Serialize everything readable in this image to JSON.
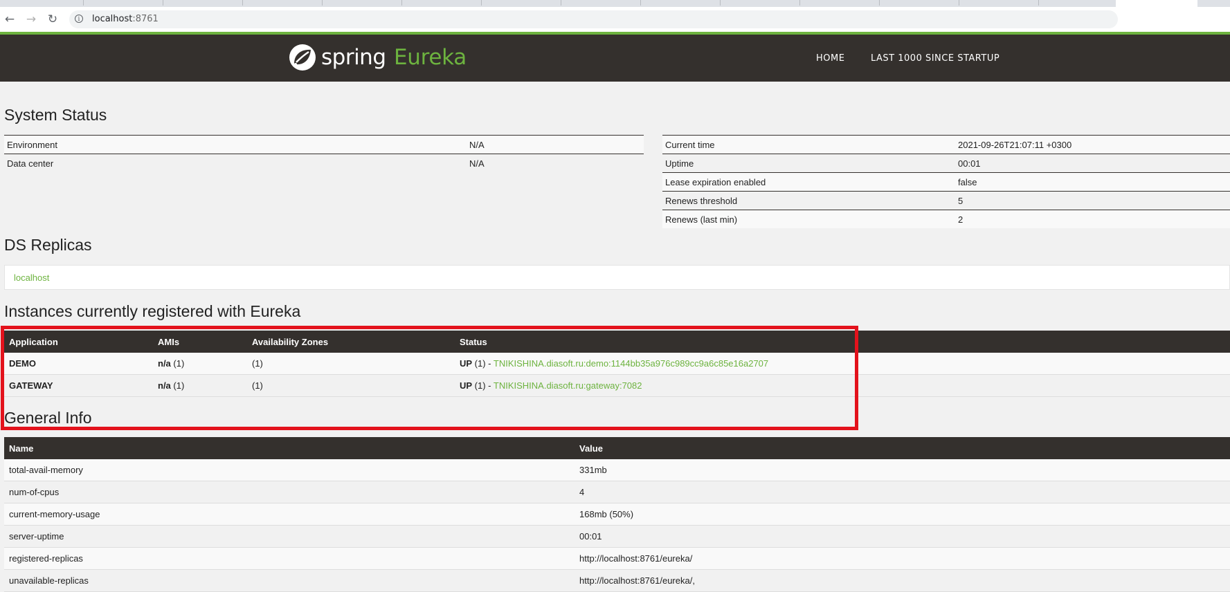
{
  "browser": {
    "url_host": "localhost",
    "url_port": ":8761"
  },
  "header": {
    "logo_spring": "spring",
    "logo_eureka": "Eureka",
    "nav": [
      {
        "label": "HOME"
      },
      {
        "label": "LAST 1000 SINCE STARTUP"
      }
    ]
  },
  "system_status": {
    "title": "System Status",
    "left": [
      {
        "key": "Environment",
        "value": "N/A"
      },
      {
        "key": "Data center",
        "value": "N/A"
      }
    ],
    "right": [
      {
        "key": "Current time",
        "value": "2021-09-26T21:07:11 +0300"
      },
      {
        "key": "Uptime",
        "value": "00:01"
      },
      {
        "key": "Lease expiration enabled",
        "value": "false"
      },
      {
        "key": "Renews threshold",
        "value": "5"
      },
      {
        "key": "Renews (last min)",
        "value": "2"
      }
    ]
  },
  "ds_replicas": {
    "title": "DS Replicas",
    "items": [
      "localhost"
    ]
  },
  "instances": {
    "title": "Instances currently registered with Eureka",
    "columns": [
      "Application",
      "AMIs",
      "Availability Zones",
      "Status"
    ],
    "rows": [
      {
        "application": "DEMO",
        "amis_bold": "n/a",
        "amis_count": " (1)",
        "zones": "(1)",
        "status_bold": "UP",
        "status_count": " (1) - ",
        "instance": "TNIKISHINA.diasoft.ru:demo:1144bb35a976c989cc9a6c85e16a2707"
      },
      {
        "application": "GATEWAY",
        "amis_bold": "n/a",
        "amis_count": " (1)",
        "zones": "(1)",
        "status_bold": "UP",
        "status_count": " (1) - ",
        "instance": "TNIKISHINA.diasoft.ru:gateway:7082"
      }
    ]
  },
  "general_info": {
    "title": "General Info",
    "columns": [
      "Name",
      "Value"
    ],
    "rows": [
      {
        "name": "total-avail-memory",
        "value": "331mb"
      },
      {
        "name": "num-of-cpus",
        "value": "4"
      },
      {
        "name": "current-memory-usage",
        "value": "168mb (50%)"
      },
      {
        "name": "server-uptime",
        "value": "00:01"
      },
      {
        "name": "registered-replicas",
        "value": "http://localhost:8761/eureka/"
      },
      {
        "name": "unavailable-replicas",
        "value": "http://localhost:8761/eureka/,"
      }
    ]
  },
  "colors": {
    "brand_green": "#6db33f",
    "header_dark": "#34302d",
    "highlight_red": "#e3121c"
  }
}
